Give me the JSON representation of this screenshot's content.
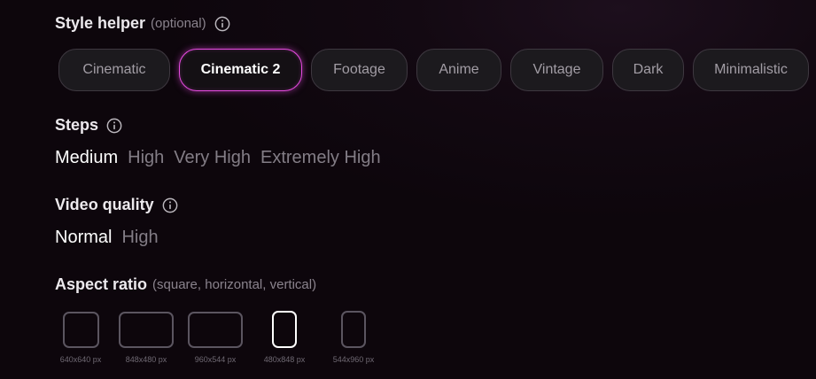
{
  "style_helper": {
    "title": "Style helper",
    "hint": "(optional)",
    "icon": "info-icon",
    "chips": [
      {
        "label": "Cinematic",
        "selected": false
      },
      {
        "label": "Cinematic 2",
        "selected": true
      },
      {
        "label": "Footage",
        "selected": false
      },
      {
        "label": "Anime",
        "selected": false
      },
      {
        "label": "Vintage",
        "selected": false
      },
      {
        "label": "Dark",
        "selected": false
      },
      {
        "label": "Minimalistic",
        "selected": false
      }
    ]
  },
  "steps": {
    "title": "Steps",
    "icon": "info-icon",
    "options": [
      {
        "label": "Medium",
        "selected": true
      },
      {
        "label": "High",
        "selected": false
      },
      {
        "label": "Very High",
        "selected": false
      },
      {
        "label": "Extremely High",
        "selected": false
      }
    ]
  },
  "video_quality": {
    "title": "Video quality",
    "icon": "info-icon",
    "options": [
      {
        "label": "Normal",
        "selected": true
      },
      {
        "label": "High",
        "selected": false
      }
    ]
  },
  "aspect_ratio": {
    "title": "Aspect ratio",
    "hint": "(square, horizontal, vertical)",
    "options": [
      {
        "label": "640x640 px",
        "selected": false
      },
      {
        "label": "848x480 px",
        "selected": false
      },
      {
        "label": "960x544 px",
        "selected": false
      },
      {
        "label": "480x848 px",
        "selected": true
      },
      {
        "label": "544x960 px",
        "selected": false
      }
    ]
  },
  "colors": {
    "accent": "#e64ae0",
    "background": "#0d060c",
    "chip_background": "#1c1a1e",
    "muted_text": "#837d86"
  }
}
